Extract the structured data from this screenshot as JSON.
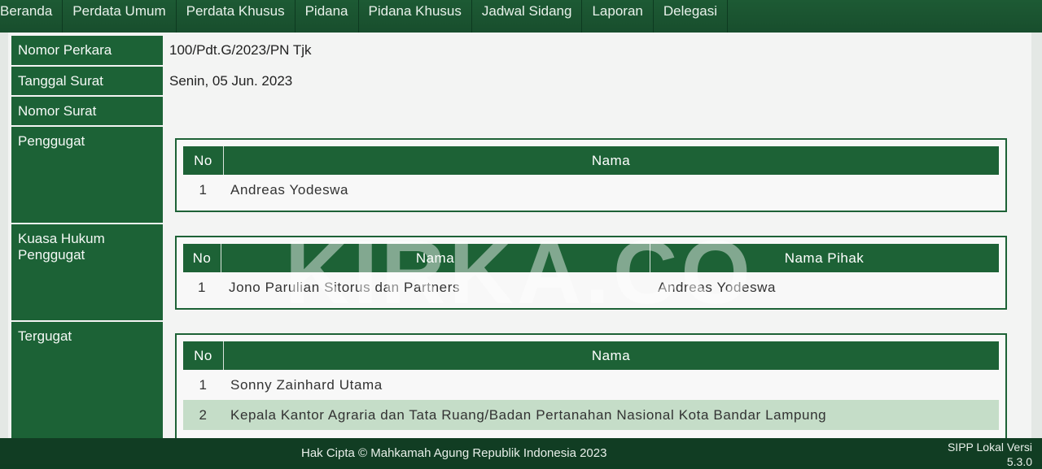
{
  "nav": {
    "items": [
      "Beranda",
      "Perdata Umum",
      "Perdata Khusus",
      "Pidana",
      "Pidana Khusus",
      "Jadwal Sidang",
      "Laporan",
      "Delegasi"
    ]
  },
  "fields": {
    "nomor_perkara": {
      "label": "Nomor Perkara",
      "value": "100/Pdt.G/2023/PN Tjk"
    },
    "tanggal_surat": {
      "label": "Tanggal Surat",
      "value": "Senin, 05 Jun. 2023"
    },
    "nomor_surat": {
      "label": "Nomor Surat",
      "value": ""
    },
    "penggugat_label": "Penggugat",
    "kuasa_label_line1": "Kuasa Hukum",
    "kuasa_label_line2": "Penggugat",
    "tergugat_label": "Tergugat"
  },
  "penggugat_table": {
    "headers": [
      "No",
      "Nama"
    ],
    "rows": [
      [
        "1",
        "Andreas Yodeswa"
      ]
    ]
  },
  "kuasa_table": {
    "headers": [
      "No",
      "Nama",
      "Nama Pihak"
    ],
    "rows": [
      [
        "1",
        "Jono Parulian Sitorus dan Partners",
        "Andreas Yodeswa"
      ]
    ]
  },
  "tergugat_table": {
    "headers": [
      "No",
      "Nama"
    ],
    "rows": [
      [
        "1",
        "Sonny Zainhard Utama"
      ],
      [
        "2",
        "Kepala Kantor Agraria dan Tata Ruang/Badan Pertanahan Nasional Kota Bandar Lampung"
      ]
    ]
  },
  "watermark": "KIRKA.CO",
  "footer": {
    "copyright": "Hak Cipta © Mahkamah Agung Republik Indonesia 2023",
    "version_line1": "SIPP Lokal Versi",
    "version_line2": "5.3.0"
  }
}
